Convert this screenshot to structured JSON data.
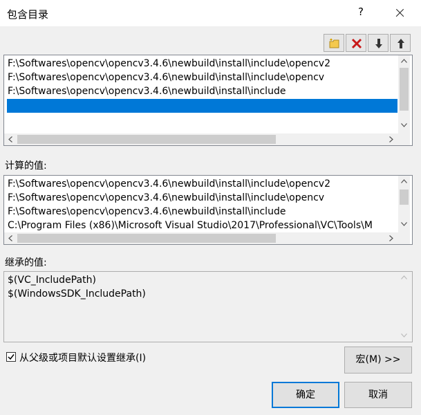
{
  "window": {
    "title": "包含目录",
    "help_label": "?"
  },
  "toolbar": {
    "buttons": [
      {
        "name": "new-line",
        "icon": "new-folder-icon"
      },
      {
        "name": "delete",
        "icon": "delete-x-icon"
      },
      {
        "name": "move-down",
        "icon": "arrow-down-icon"
      },
      {
        "name": "move-up",
        "icon": "arrow-up-icon"
      }
    ]
  },
  "edit_list": {
    "items": [
      "F:\\Softwares\\opencv\\opencv3.4.6\\newbuild\\install\\include\\opencv2",
      "F:\\Softwares\\opencv\\opencv3.4.6\\newbuild\\install\\include\\opencv",
      "F:\\Softwares\\opencv\\opencv3.4.6\\newbuild\\install\\include",
      ""
    ],
    "selected_index": 3
  },
  "computed": {
    "label": "计算的值:",
    "items": [
      "F:\\Softwares\\opencv\\opencv3.4.6\\newbuild\\install\\include\\opencv2",
      "F:\\Softwares\\opencv\\opencv3.4.6\\newbuild\\install\\include\\opencv",
      "F:\\Softwares\\opencv\\opencv3.4.6\\newbuild\\install\\include",
      "C:\\Program Files (x86)\\Microsoft Visual Studio\\2017\\Professional\\VC\\Tools\\M"
    ]
  },
  "inherited": {
    "label": "继承的值:",
    "items": [
      "$(VC_IncludePath)",
      "$(WindowsSDK_IncludePath)"
    ]
  },
  "inherit_checkbox": {
    "label": "从父级或项目默认设置继承(I)",
    "checked": true
  },
  "buttons": {
    "macro": "宏(M) >>",
    "ok": "确定",
    "cancel": "取消"
  },
  "colors": {
    "selection": "#0078d7",
    "dialog_bg": "#f0f0f0"
  }
}
